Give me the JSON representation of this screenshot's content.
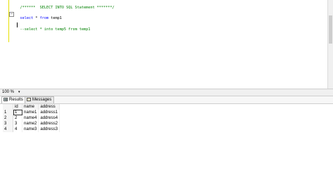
{
  "editor": {
    "lines": [
      {
        "parts": [
          {
            "cls": "comment",
            "text": "/******  SELECT INTO SQL Statement *******/"
          }
        ]
      },
      {
        "parts": [
          {
            "cls": "kw",
            "text": "select"
          },
          {
            "cls": "txt",
            "text": " * "
          },
          {
            "cls": "kw",
            "text": "from"
          },
          {
            "cls": "txt",
            "text": " temp1"
          }
        ]
      },
      {
        "parts": [
          {
            "cls": "comment",
            "text": "--select * into temp5 from temp1"
          }
        ]
      }
    ]
  },
  "zoom": {
    "label": "100 %",
    "arrow": "▾"
  },
  "tabs": [
    {
      "label": "Results",
      "icon": "grid-icon",
      "active": true
    },
    {
      "label": "Messages",
      "icon": "message-icon",
      "active": false
    }
  ],
  "results": {
    "columns": [
      "id",
      "name",
      "address"
    ],
    "rows": [
      {
        "row": "1",
        "id": "1",
        "name": "name1",
        "address": "address1"
      },
      {
        "row": "2",
        "id": "2",
        "name": "name4",
        "address": "address4"
      },
      {
        "row": "3",
        "id": "3",
        "name": "name2",
        "address": "address2"
      },
      {
        "row": "4",
        "id": "4",
        "name": "name3",
        "address": "address3"
      }
    ]
  }
}
